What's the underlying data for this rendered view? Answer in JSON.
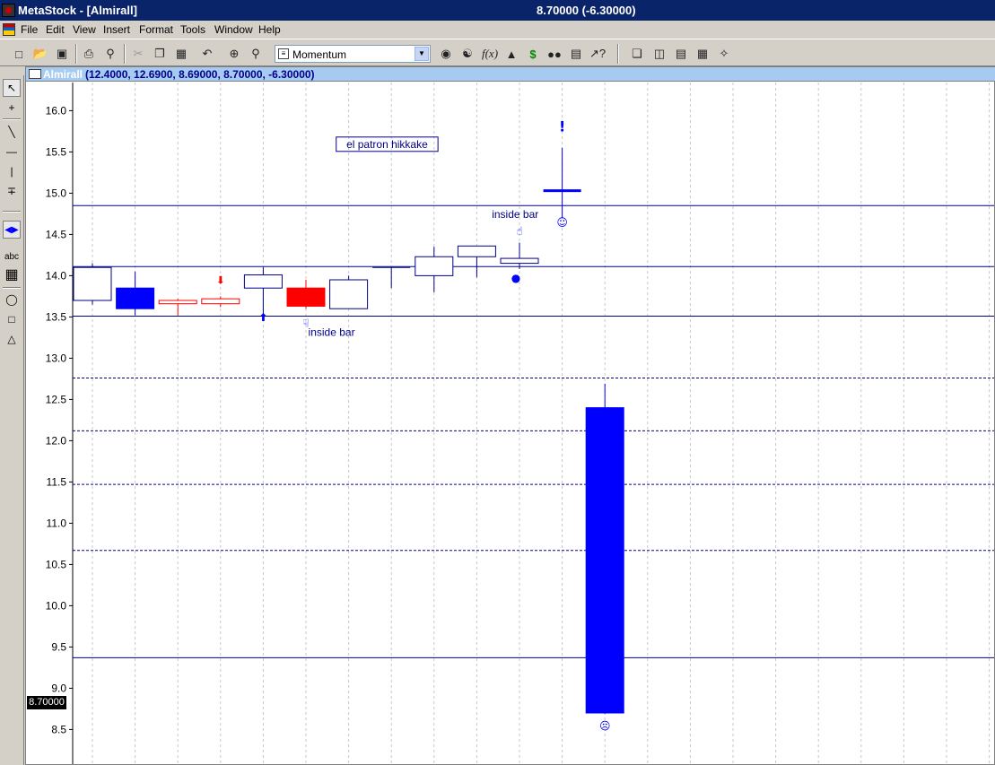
{
  "window": {
    "title": "MetaStock - [Almirall]",
    "price_readout": "8.70000 (-6.30000)"
  },
  "menu": [
    "File",
    "Edit",
    "View",
    "Insert",
    "Format",
    "Tools",
    "Window",
    "Help"
  ],
  "toolbar": {
    "indicator_value": "Momentum"
  },
  "chart_window": {
    "security_name": "Almirall",
    "ohlc_values": "(12.4000, 12.6900, 8.69000, 8.70000, -6.30000)",
    "last_price_flag": "8.70000"
  },
  "colors": {
    "navy": "#00008b",
    "blue": "#0000ff",
    "red": "#ff0000",
    "title_bar": "#0a246a",
    "header_bar": "#a6caf0"
  },
  "chart_data": {
    "type": "candlestick",
    "ylim": [
      8.0,
      16.2
    ],
    "yticks": [
      "16.0",
      "15.5",
      "15.0",
      "14.5",
      "14.0",
      "13.5",
      "13.0",
      "12.5",
      "12.0",
      "11.5",
      "11.0",
      "10.5",
      "10.0",
      "9.5",
      "9.0",
      "8.5"
    ],
    "candles": [
      {
        "open": 14.1,
        "high": 14.15,
        "low": 13.65,
        "close": 13.7,
        "color": "navy",
        "filled": false
      },
      {
        "open": 13.85,
        "high": 14.05,
        "low": 13.52,
        "close": 13.6,
        "color": "blue",
        "filled": true
      },
      {
        "open": 13.7,
        "high": 13.72,
        "low": 13.52,
        "close": 13.66,
        "color": "red",
        "filled": false
      },
      {
        "open": 13.72,
        "high": 13.75,
        "low": 13.62,
        "close": 13.66,
        "color": "red",
        "filled": false
      },
      {
        "open": 13.85,
        "high": 14.1,
        "low": 13.52,
        "close": 14.01,
        "color": "navy",
        "filled": false
      },
      {
        "open": 13.85,
        "high": 13.95,
        "low": 13.6,
        "close": 13.63,
        "color": "red",
        "filled": true
      },
      {
        "open": 13.6,
        "high": 14.0,
        "low": 13.6,
        "close": 13.95,
        "color": "navy",
        "filled": false
      },
      {
        "open": 14.1,
        "high": 14.1,
        "low": 13.85,
        "close": 14.1,
        "color": "navy",
        "filled": false
      },
      {
        "open": 14.0,
        "high": 14.35,
        "low": 13.8,
        "close": 14.23,
        "color": "navy",
        "filled": false
      },
      {
        "open": 14.23,
        "high": 14.35,
        "low": 13.98,
        "close": 14.36,
        "color": "navy",
        "filled": false
      },
      {
        "open": 14.15,
        "high": 14.4,
        "low": 14.08,
        "close": 14.21,
        "color": "navy",
        "filled": false
      },
      {
        "open": 15.03,
        "high": 15.55,
        "low": 14.7,
        "close": 15.03,
        "color": "blue",
        "filled": false
      },
      {
        "open": 12.4,
        "high": 12.69,
        "low": 8.69,
        "close": 8.7,
        "color": "blue",
        "filled": true
      }
    ],
    "hlines_solid": [
      14.85,
      14.11,
      13.51,
      9.37
    ],
    "hlines_dotted": [
      12.76,
      12.12,
      11.47,
      10.67
    ],
    "annotations": [
      {
        "text": "el patron hikkake",
        "boxed": true,
        "at": 15.55,
        "bar": 6.9
      },
      {
        "text": "inside bar",
        "boxed": false,
        "at": 13.27,
        "bar": 5.6
      },
      {
        "text": "inside bar",
        "boxed": false,
        "at": 14.7,
        "bar": 9.9
      }
    ],
    "markers": [
      {
        "kind": "arrow-down",
        "bar": 3,
        "at": 13.9,
        "color": "red"
      },
      {
        "kind": "arrow-up",
        "bar": 4,
        "at": 13.45,
        "color": "blue"
      },
      {
        "kind": "hand-down",
        "bar": 5,
        "at": 13.38,
        "color": "blue"
      },
      {
        "kind": "hand-up",
        "bar": 10,
        "at": 14.5,
        "color": "blue"
      },
      {
        "kind": "bomb",
        "bar": 10,
        "at": 13.93,
        "color": "blue"
      },
      {
        "kind": "exclamation",
        "bar": 11,
        "at": 15.75,
        "color": "blue"
      },
      {
        "kind": "smiley-happy",
        "bar": 11,
        "at": 14.6,
        "color": "blue"
      },
      {
        "kind": "smiley-sad",
        "bar": 12,
        "at": 8.5,
        "color": "blue"
      }
    ]
  }
}
